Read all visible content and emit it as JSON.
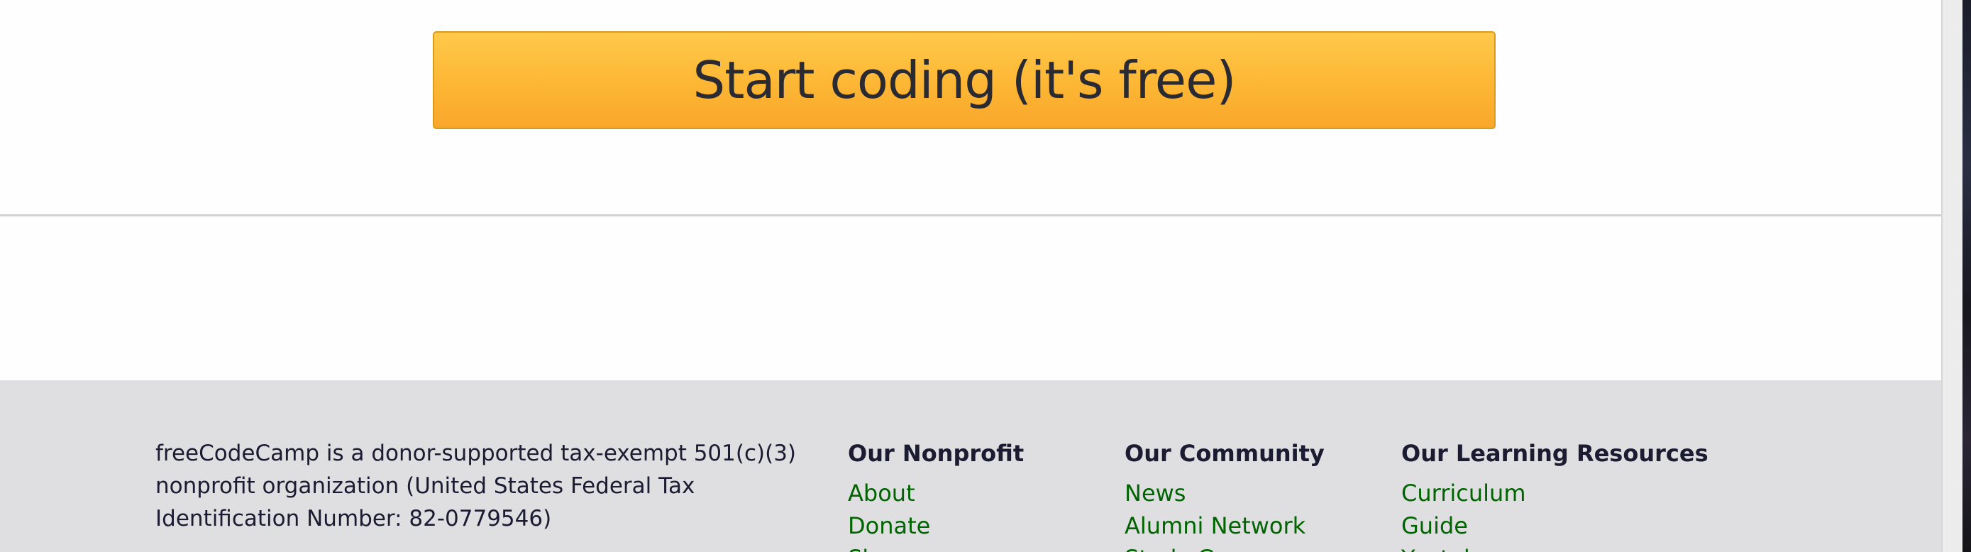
{
  "cta": {
    "label": "Start coding (it's free)"
  },
  "footer": {
    "description": "freeCodeCamp is a donor-supported tax-exempt 501(c)(3) nonprofit organization (United States Federal Tax Identification Number: 82-0779546)",
    "columns": [
      {
        "heading": "Our Nonprofit",
        "links": [
          "About",
          "Donate",
          "Shop"
        ]
      },
      {
        "heading": "Our Community",
        "links": [
          "News",
          "Alumni Network",
          "Study Groups"
        ]
      },
      {
        "heading": "Our Learning Resources",
        "links": [
          "Curriculum",
          "Guide",
          "Youtube"
        ]
      }
    ]
  },
  "colors": {
    "cta_background": "#fdb634",
    "cta_border": "#d99a1e",
    "cta_text": "#2a2a33",
    "footer_background": "#dfdfe2",
    "footer_text": "#1b1b32",
    "link_color": "#006400",
    "divider": "#d0d0d5"
  }
}
